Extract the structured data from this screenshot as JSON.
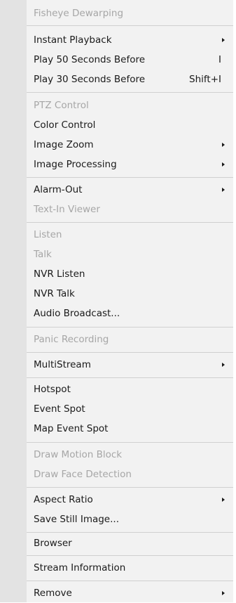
{
  "menu": {
    "items": [
      {
        "label": "Fisheye Dewarping",
        "disabled": true
      },
      {
        "label": "Instant Playback",
        "submenu": true
      },
      {
        "label": "Play 50 Seconds Before",
        "shortcut": "I"
      },
      {
        "label": "Play 30 Seconds Before",
        "shortcut": "Shift+I"
      },
      {
        "label": "PTZ Control",
        "disabled": true
      },
      {
        "label": "Color Control"
      },
      {
        "label": "Image Zoom",
        "submenu": true
      },
      {
        "label": "Image Processing",
        "submenu": true
      },
      {
        "label": "Alarm-Out",
        "submenu": true
      },
      {
        "label": "Text-In Viewer",
        "disabled": true
      },
      {
        "label": "Listen",
        "disabled": true
      },
      {
        "label": "Talk",
        "disabled": true
      },
      {
        "label": "NVR Listen"
      },
      {
        "label": "NVR Talk"
      },
      {
        "label": "Audio Broadcast..."
      },
      {
        "label": "Panic Recording",
        "disabled": true
      },
      {
        "label": "MultiStream",
        "submenu": true
      },
      {
        "label": "Hotspot"
      },
      {
        "label": "Event Spot"
      },
      {
        "label": "Map Event Spot"
      },
      {
        "label": "Draw Motion Block",
        "disabled": true
      },
      {
        "label": "Draw Face Detection",
        "disabled": true
      },
      {
        "label": "Aspect Ratio",
        "submenu": true
      },
      {
        "label": "Save Still Image..."
      },
      {
        "label": "Browser"
      },
      {
        "label": "Stream Information"
      },
      {
        "label": "Remove",
        "submenu": true
      }
    ]
  }
}
